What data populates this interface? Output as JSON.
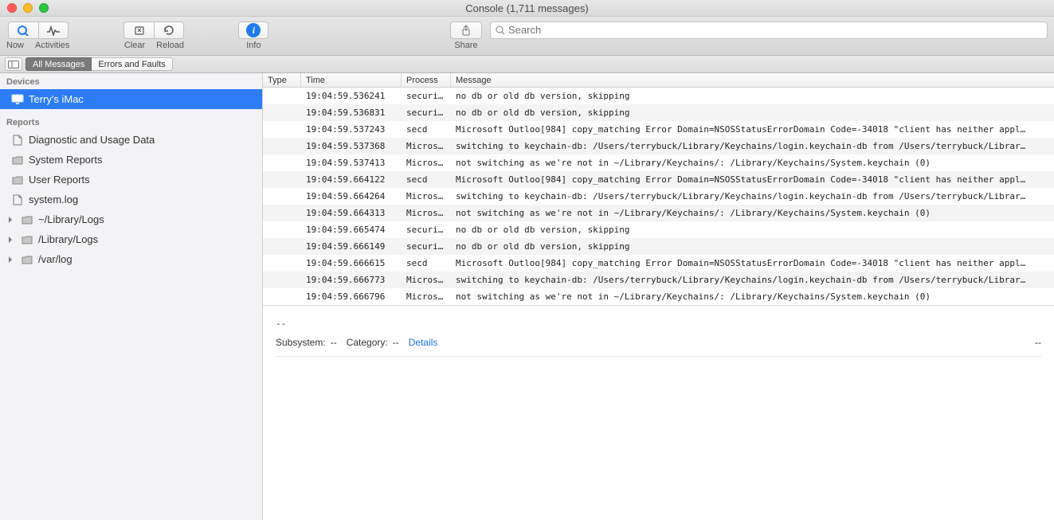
{
  "window": {
    "title": "Console (1,711 messages)"
  },
  "toolbar": {
    "now": "Now",
    "activities": "Activities",
    "clear": "Clear",
    "reload": "Reload",
    "info": "Info",
    "share": "Share",
    "search_placeholder": "Search"
  },
  "filter": {
    "all_messages": "All Messages",
    "errors_faults": "Errors and Faults"
  },
  "sidebar": {
    "devices_head": "Devices",
    "device": "Terry's iMac",
    "reports_head": "Reports",
    "diag": "Diagnostic and Usage Data",
    "sysrep": "System Reports",
    "userrep": "User Reports",
    "syslog": "system.log",
    "liblogs": "~/Library/Logs",
    "rootliblogs": "/Library/Logs",
    "varlog": "/var/log"
  },
  "columns": {
    "type": "Type",
    "time": "Time",
    "process": "Process",
    "message": "Message"
  },
  "rows": [
    {
      "time": "19:04:59.536241",
      "proc": "securi…",
      "msg": "no db or old db version, skipping"
    },
    {
      "time": "19:04:59.536831",
      "proc": "securi…",
      "msg": "no db or old db version, skipping"
    },
    {
      "time": "19:04:59.537243",
      "proc": "secd",
      "msg": "Microsoft Outloo[984] copy_matching Error Domain=NSOSStatusErrorDomain Code=-34018 \"client has neither appl…"
    },
    {
      "time": "19:04:59.537368",
      "proc": "Micros…",
      "msg": "switching to keychain-db: /Users/terrybuck/Library/Keychains/login.keychain-db from /Users/terrybuck/Librar…"
    },
    {
      "time": "19:04:59.537413",
      "proc": "Micros…",
      "msg": "not switching as we're not in ~/Library/Keychains/: /Library/Keychains/System.keychain (0)"
    },
    {
      "time": "19:04:59.664122",
      "proc": "secd",
      "msg": "Microsoft Outloo[984] copy_matching Error Domain=NSOSStatusErrorDomain Code=-34018 \"client has neither appl…"
    },
    {
      "time": "19:04:59.664264",
      "proc": "Micros…",
      "msg": "switching to keychain-db: /Users/terrybuck/Library/Keychains/login.keychain-db from /Users/terrybuck/Librar…"
    },
    {
      "time": "19:04:59.664313",
      "proc": "Micros…",
      "msg": "not switching as we're not in ~/Library/Keychains/: /Library/Keychains/System.keychain (0)"
    },
    {
      "time": "19:04:59.665474",
      "proc": "securi…",
      "msg": "no db or old db version, skipping"
    },
    {
      "time": "19:04:59.666149",
      "proc": "securi…",
      "msg": "no db or old db version, skipping"
    },
    {
      "time": "19:04:59.666615",
      "proc": "secd",
      "msg": "Microsoft Outloo[984] copy_matching Error Domain=NSOSStatusErrorDomain Code=-34018 \"client has neither appl…"
    },
    {
      "time": "19:04:59.666773",
      "proc": "Micros…",
      "msg": "switching to keychain-db: /Users/terrybuck/Library/Keychains/login.keychain-db from /Users/terrybuck/Librar…"
    },
    {
      "time": "19:04:59.666796",
      "proc": "Micros…",
      "msg": "not switching as we're not in ~/Library/Keychains/: /Library/Keychains/System.keychain (0)"
    }
  ],
  "detail": {
    "dashes": "--",
    "subsystem_k": "Subsystem:",
    "subsystem_v": "--",
    "category_k": "Category:",
    "category_v": "--",
    "details_link": "Details",
    "right_dash": "--"
  }
}
